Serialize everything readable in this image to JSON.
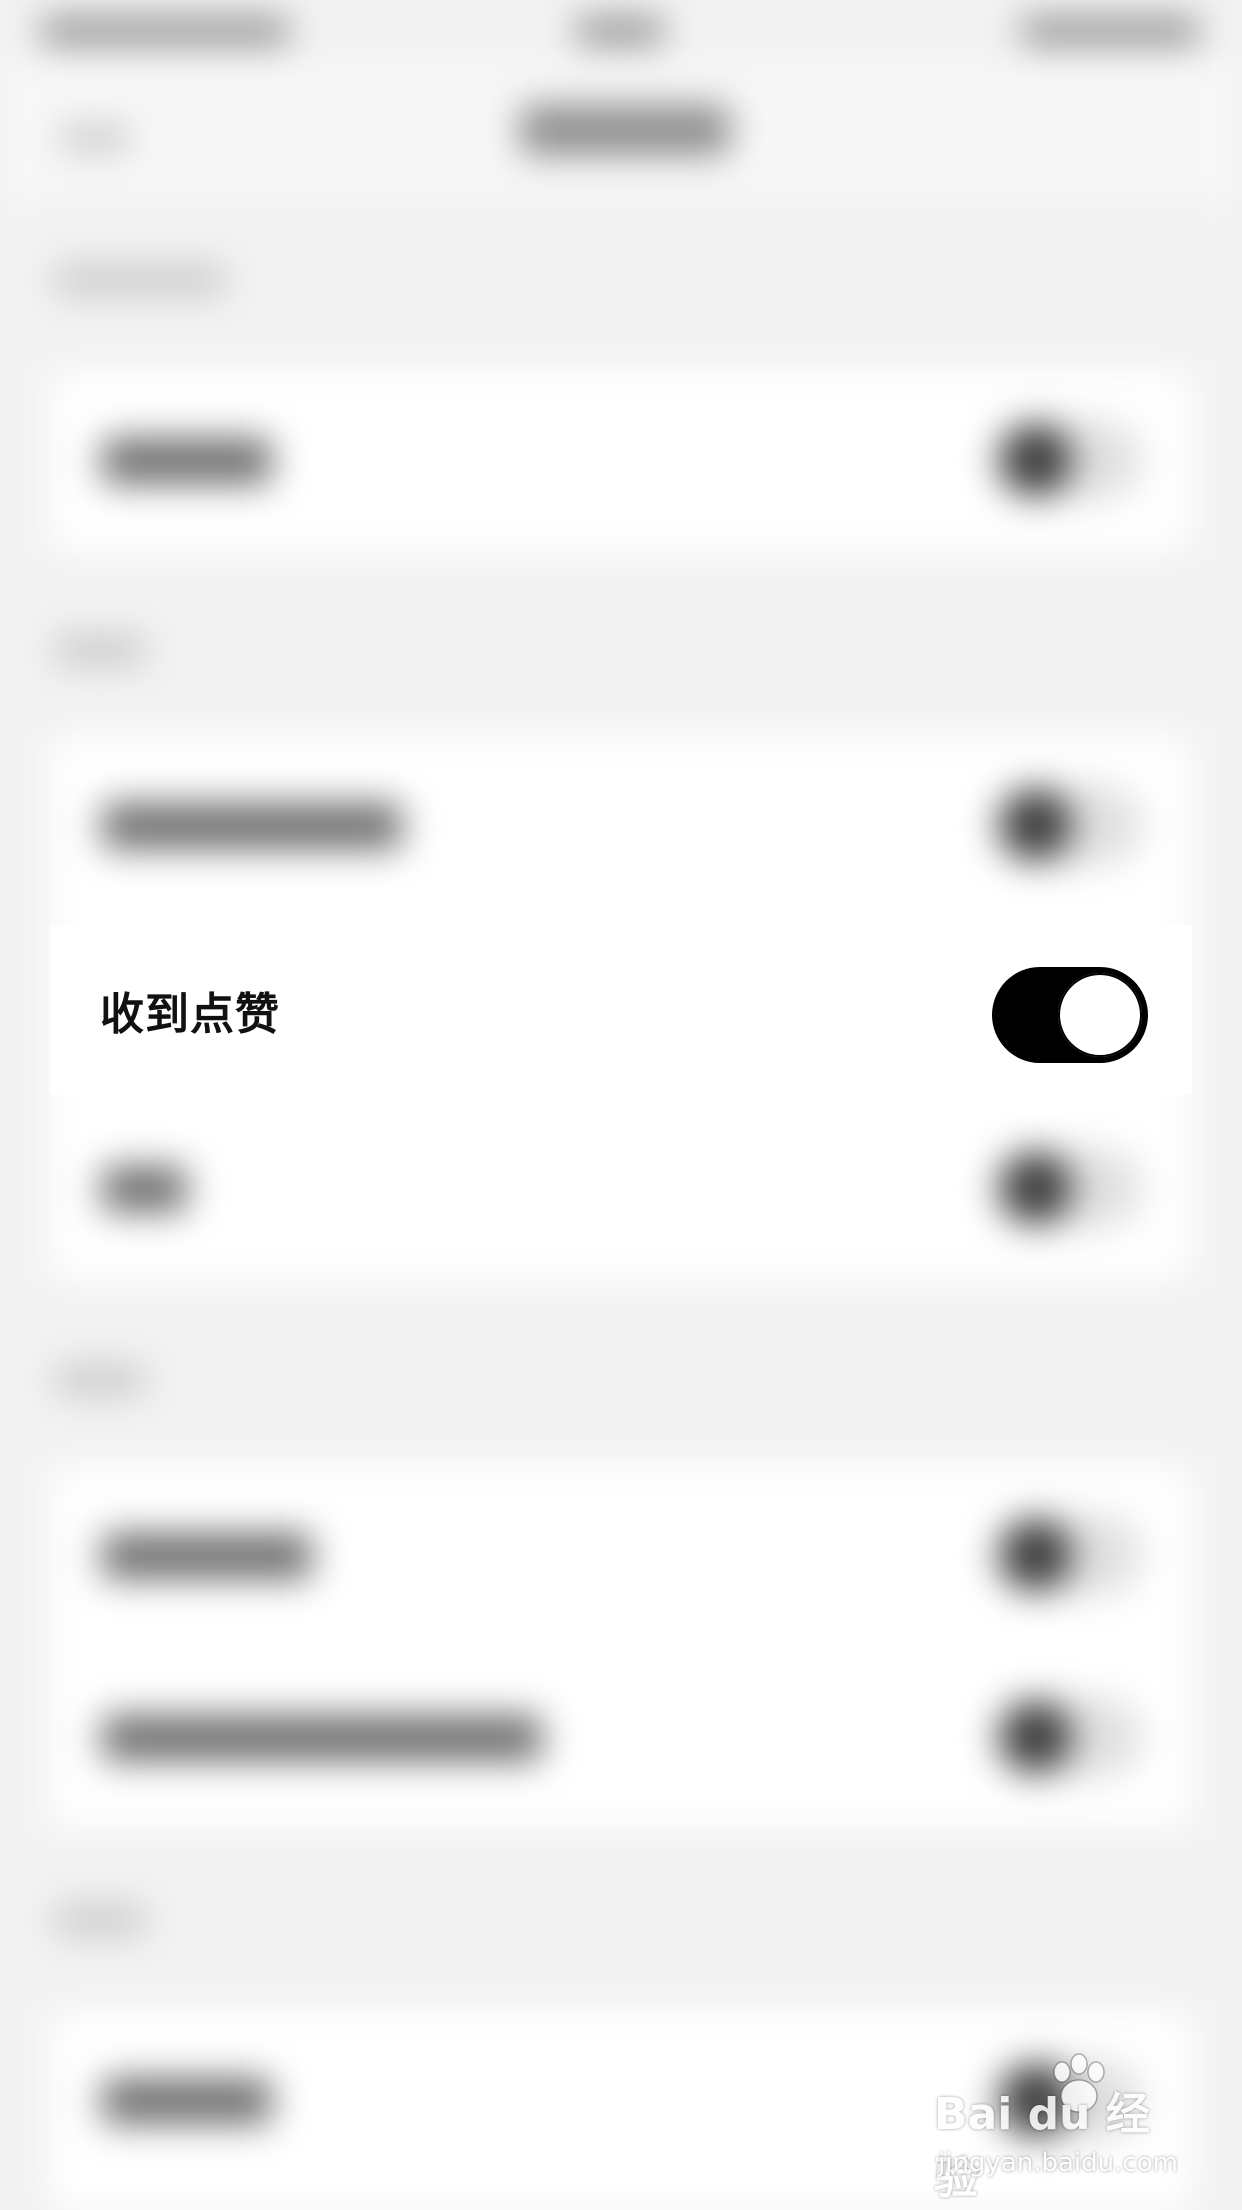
{
  "screen": {
    "highlighted_item": {
      "label": "收到点赞",
      "toggle_on": true
    }
  },
  "watermark": {
    "brand": "Bai du 经验",
    "url": "jingyan.baidu.com"
  },
  "colors": {
    "background": "#f2f2f2",
    "card": "#ffffff",
    "toggle_on": "#000000",
    "text": "#111111"
  }
}
